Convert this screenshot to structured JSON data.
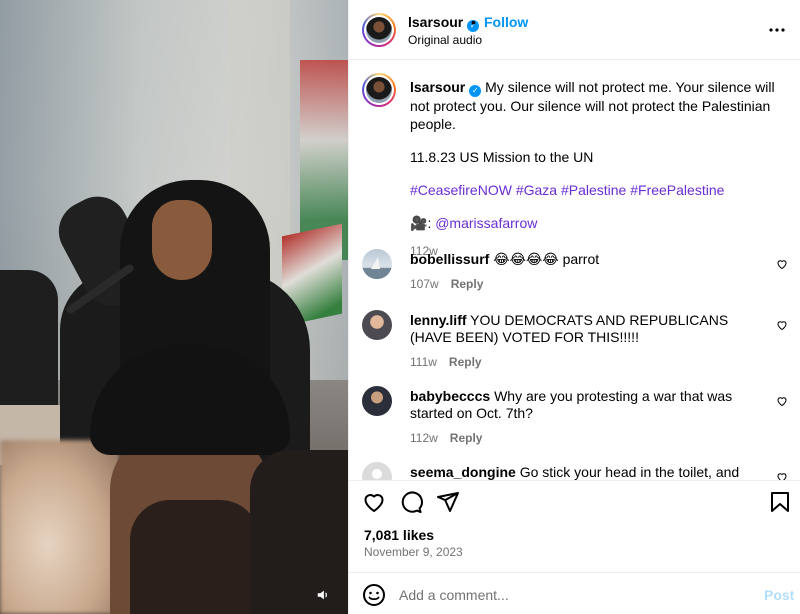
{
  "post": {
    "username": "lsarsour",
    "follow_label": "Follow",
    "separator": "•",
    "audio_label": "Original audio",
    "caption": {
      "text": "My silence will not protect me. Your silence will not protect you. Our silence will not protect the Palestinian people.",
      "line2": "11.8.23 US Mission to the UN",
      "hashtags": [
        "#CeasefireNOW",
        "#Gaza",
        "#Palestine",
        "#FreePalestine"
      ],
      "credit_icon": "🎥",
      "credit_prefix": ": ",
      "credit_handle": "@marissafarrow",
      "age": "112w"
    },
    "likes": "7,081 likes",
    "date": "November 9, 2023"
  },
  "comments": [
    {
      "username": "bobellissurf",
      "text": "😂😂😂😂 parrot",
      "age": "107w",
      "reply_label": "Reply"
    },
    {
      "username": "lenny.liff",
      "text": "YOU DEMOCRATS AND REPUBLICANS (HAVE BEEN) VOTED FOR THIS!!!!!",
      "age": "111w",
      "reply_label": "Reply"
    },
    {
      "username": "babybecccs",
      "text": "Why are you protesting a war that was started on Oct. 7th?",
      "age": "112w",
      "reply_label": "Reply"
    },
    {
      "username": "seema_dongine",
      "text": "Go stick your head in the toilet, and stay there"
    }
  ],
  "add_comment": {
    "placeholder": "Add a comment...",
    "post_label": "Post"
  },
  "colors": {
    "accent": "#0095f6",
    "hashtag": "#6b2ed6",
    "muted": "#737373",
    "post_disabled": "#b2dffc"
  },
  "icons": {
    "more": "more-options-icon",
    "verified": "verified-badge-icon",
    "like": "heart-icon",
    "comment": "comment-bubble-icon",
    "share": "paper-plane-icon",
    "save": "bookmark-icon",
    "emoji": "smiley-icon",
    "sound": "speaker-icon"
  }
}
